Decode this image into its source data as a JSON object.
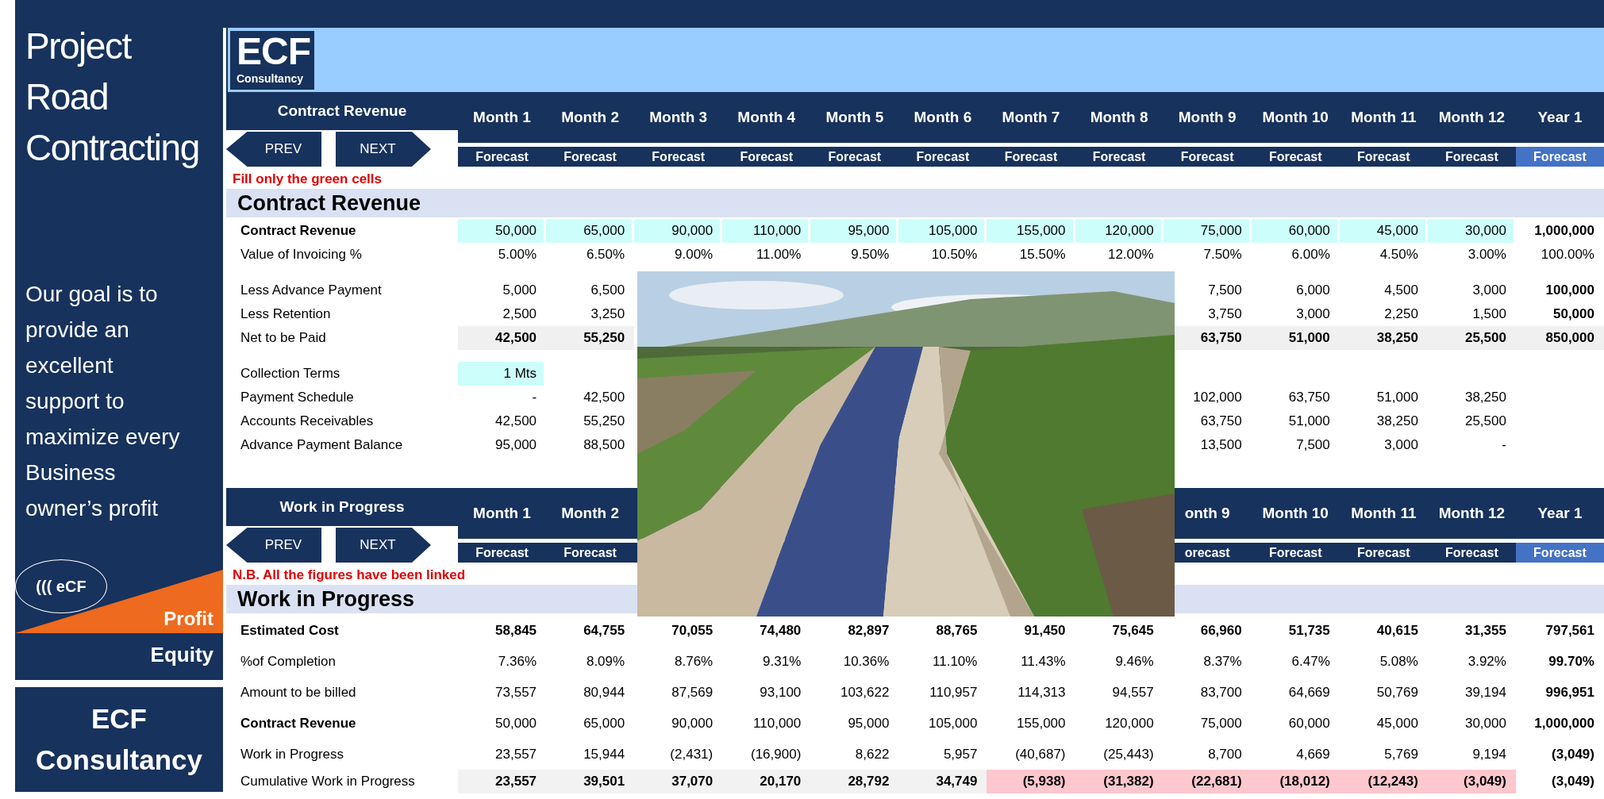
{
  "sidebar": {
    "title": "Project Road Contracting",
    "goal": "Our goal is to provide an excellent support to maximize every Business owner’s profit",
    "badge": "((( eCF",
    "profit_label": "Profit",
    "equity_label": "Equity",
    "brand": "ECF Consultancy"
  },
  "logo": {
    "name": "ECF",
    "sub": "Consultancy"
  },
  "sections": [
    {
      "title": "Contract Revenue",
      "prev": "PREV",
      "next": "NEXT",
      "note": "Fill only the green cells",
      "heading": "Contract Revenue",
      "columns": [
        {
          "label": "Month 1",
          "subhead": "Forecast",
          "kind": "month"
        },
        {
          "label": "Month 2",
          "subhead": "Forecast",
          "kind": "month"
        },
        {
          "label": "Month 3",
          "subhead": "Forecast",
          "kind": "month"
        },
        {
          "label": "Month 4",
          "subhead": "Forecast",
          "kind": "month"
        },
        {
          "label": "Month 5",
          "subhead": "Forecast",
          "kind": "month"
        },
        {
          "label": "Month 6",
          "subhead": "Forecast",
          "kind": "month"
        },
        {
          "label": "Month 7",
          "subhead": "Forecast",
          "kind": "month"
        },
        {
          "label": "Month 8",
          "subhead": "Forecast",
          "kind": "month"
        },
        {
          "label": "Month 9",
          "subhead": "Forecast",
          "kind": "month"
        },
        {
          "label": "Month 10",
          "subhead": "Forecast",
          "kind": "month"
        },
        {
          "label": "Month 11",
          "subhead": "Forecast",
          "kind": "month"
        },
        {
          "label": "Month 12",
          "subhead": "Forecast",
          "kind": "month"
        },
        {
          "label": "Year 1",
          "subhead": "Forecast",
          "kind": "year"
        }
      ],
      "rows": [
        {
          "kind": "input",
          "photo_gap": false,
          "label": "Contract Revenue",
          "label_bold": true,
          "values_bold": false,
          "year_bold": true,
          "values": [
            "50,000",
            "65,000",
            "90,000",
            "110,000",
            "95,000",
            "105,000",
            "155,000",
            "120,000",
            "75,000",
            "60,000",
            "45,000",
            "30,000",
            "1,000,000"
          ]
        },
        {
          "kind": "plain",
          "photo_gap": false,
          "label": "Value of Invoicing %",
          "label_bold": false,
          "values_bold": false,
          "year_bold": false,
          "values": [
            "5.00%",
            "6.50%",
            "9.00%",
            "11.00%",
            "9.50%",
            "10.50%",
            "15.50%",
            "12.00%",
            "7.50%",
            "6.00%",
            "4.50%",
            "3.00%",
            "100.00%"
          ]
        },
        {
          "kind": "spacer"
        },
        {
          "kind": "plain",
          "photo_gap": true,
          "label": "Less Advance Payment",
          "label_bold": false,
          "values_bold": false,
          "year_bold": true,
          "values": [
            "5,000",
            "6,500",
            "7,500",
            "6,000",
            "4,500",
            "3,000",
            "100,000"
          ]
        },
        {
          "kind": "plain",
          "photo_gap": true,
          "label": "Less Retention",
          "label_bold": false,
          "values_bold": false,
          "year_bold": true,
          "values": [
            "2,500",
            "3,250",
            "3,750",
            "3,000",
            "2,250",
            "1,500",
            "50,000"
          ]
        },
        {
          "kind": "total",
          "photo_gap": true,
          "label": "Net to be Paid",
          "label_bold": false,
          "values_bold": true,
          "year_bold": true,
          "values": [
            "42,500",
            "55,250",
            "63,750",
            "51,000",
            "38,250",
            "25,500",
            "850,000"
          ]
        },
        {
          "kind": "spacer"
        },
        {
          "kind": "input",
          "label": "Collection Terms",
          "label_bold": false,
          "values_bold": false,
          "values": [
            "1 Mts"
          ]
        },
        {
          "kind": "plain",
          "photo_gap": true,
          "label": "Payment Schedule",
          "label_bold": false,
          "values_bold": false,
          "values": [
            "-",
            "42,500",
            "102,000",
            "63,750",
            "51,000",
            "38,250"
          ]
        },
        {
          "kind": "plain",
          "photo_gap": true,
          "label": "Accounts Receivables",
          "label_bold": false,
          "values_bold": false,
          "values": [
            "42,500",
            "55,250",
            "63,750",
            "51,000",
            "38,250",
            "25,500"
          ]
        },
        {
          "kind": "plain",
          "photo_gap": true,
          "label": "Advance Payment Balance",
          "label_bold": false,
          "values_bold": false,
          "values": [
            "95,000",
            "88,500",
            "13,500",
            "7,500",
            "3,000",
            "-"
          ]
        }
      ]
    },
    {
      "title": "Work in Progress",
      "prev": "PREV",
      "next": "NEXT",
      "note": "N.B. All the figures have been linked",
      "heading": "Work in Progress",
      "columns": [
        {
          "label": "Month 1",
          "subhead": "Forecast",
          "kind": "month"
        },
        {
          "label": "Month 2",
          "subhead": "Forecast",
          "kind": "month"
        },
        {
          "kind": "blank"
        },
        {
          "kind": "blank"
        },
        {
          "kind": "blank"
        },
        {
          "kind": "blank"
        },
        {
          "kind": "blank"
        },
        {
          "kind": "blank"
        },
        {
          "label": "onth 9",
          "subhead": "orecast",
          "kind": "month"
        },
        {
          "label": "Month 10",
          "subhead": "Forecast",
          "kind": "month"
        },
        {
          "label": "Month 11",
          "subhead": "Forecast",
          "kind": "month"
        },
        {
          "label": "Month 12",
          "subhead": "Forecast",
          "kind": "month"
        },
        {
          "label": "Year 1",
          "subhead": "Forecast",
          "kind": "year"
        }
      ],
      "rows": [
        {
          "kind": "plain",
          "photo_gap": false,
          "label": "Estimated Cost",
          "label_bold": true,
          "values_bold": true,
          "year_bold": true,
          "values": [
            "58,845",
            "64,755",
            "70,055",
            "74,480",
            "82,897",
            "88,765",
            "91,450",
            "75,645",
            "66,960",
            "51,735",
            "40,615",
            "31,355",
            "797,561"
          ]
        },
        {
          "kind": "plain",
          "photo_gap": false,
          "label": "%of Completion",
          "label_bold": false,
          "values_bold": false,
          "year_bold": true,
          "values": [
            "7.36%",
            "8.09%",
            "8.76%",
            "9.31%",
            "10.36%",
            "11.10%",
            "11.43%",
            "9.46%",
            "8.37%",
            "6.47%",
            "5.08%",
            "3.92%",
            "99.70%"
          ]
        },
        {
          "kind": "plain",
          "photo_gap": false,
          "label": "Amount to be billed",
          "label_bold": false,
          "values_bold": false,
          "year_bold": true,
          "values": [
            "73,557",
            "80,944",
            "87,569",
            "93,100",
            "103,622",
            "110,957",
            "114,313",
            "94,557",
            "83,700",
            "64,669",
            "50,769",
            "39,194",
            "996,951"
          ]
        },
        {
          "kind": "plain",
          "photo_gap": false,
          "label": "Contract Revenue",
          "label_bold": true,
          "values_bold": false,
          "year_bold": true,
          "values": [
            "50,000",
            "65,000",
            "90,000",
            "110,000",
            "95,000",
            "105,000",
            "155,000",
            "120,000",
            "75,000",
            "60,000",
            "45,000",
            "30,000",
            "1,000,000"
          ]
        },
        {
          "kind": "plain",
          "photo_gap": false,
          "label": "Work in Progress",
          "label_bold": false,
          "values_bold": false,
          "year_bold": true,
          "values": [
            "23,557",
            "15,944",
            "(2,431)",
            "(16,900)",
            "8,622",
            "5,957",
            "(40,687)",
            "(25,443)",
            "8,700",
            "4,669",
            "5,769",
            "9,194",
            "(3,049)"
          ]
        },
        {
          "kind": "shaded",
          "label": "Cumulative Work in Progress",
          "label_bold": false,
          "values_bold": true,
          "year_bold": true,
          "cells": [
            {
              "text": "23,557",
              "color": "#f2f2f2"
            },
            {
              "text": "39,501",
              "color": "#f2f2f2"
            },
            {
              "text": "37,070",
              "color": "#f2f2f2"
            },
            {
              "text": "20,170",
              "color": "#f2f2f2"
            },
            {
              "text": "28,792",
              "color": "#f2f2f2"
            },
            {
              "text": "34,749",
              "color": "#f2f2f2"
            },
            {
              "text": "(5,938)",
              "color": "#ffc7ce"
            },
            {
              "text": "(31,382)",
              "color": "#ffc7ce"
            },
            {
              "text": "(22,681)",
              "color": "#ffc7ce"
            },
            {
              "text": "(18,012)",
              "color": "#ffc7ce"
            },
            {
              "text": "(12,243)",
              "color": "#ffc7ce"
            },
            {
              "text": "(3,049)",
              "color": "#ffc7ce"
            },
            {
              "text": "(3,049)"
            }
          ]
        }
      ]
    }
  ]
}
